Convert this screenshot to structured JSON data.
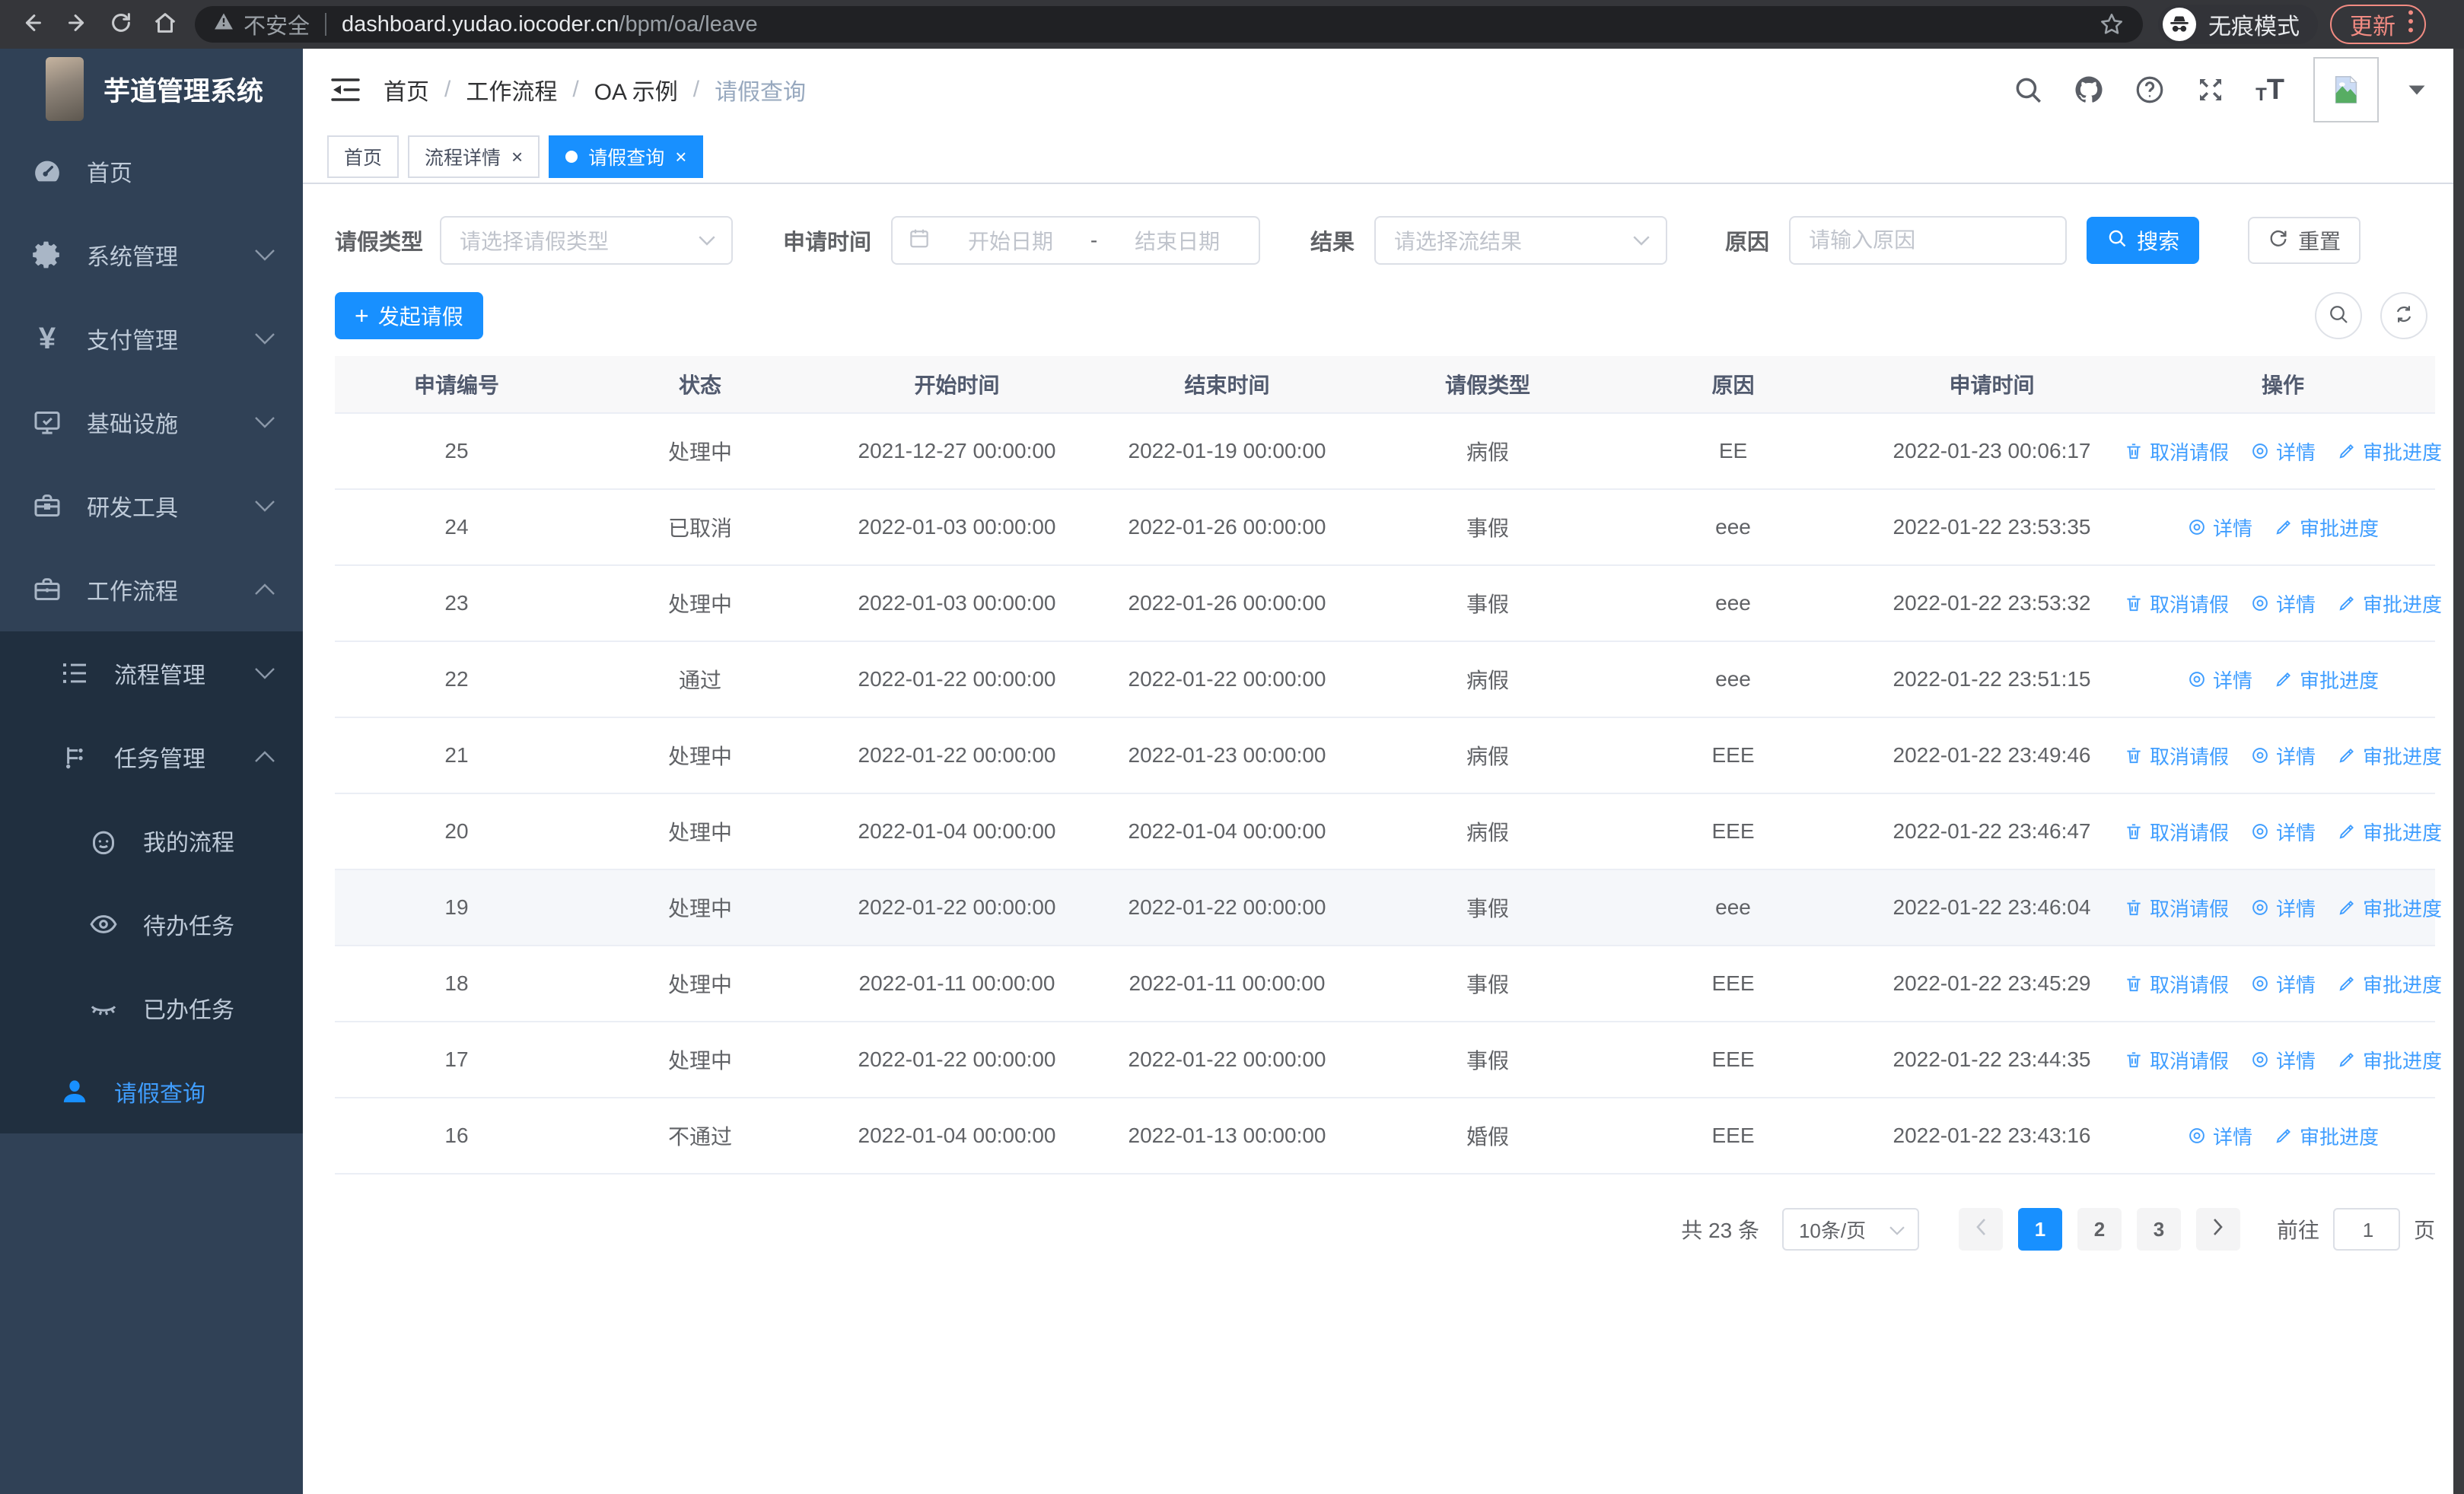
{
  "browser": {
    "security_label": "不安全",
    "url_host": "dashboard.yudao.iocoder.cn",
    "url_path": "/bpm/oa/leave",
    "incognito_label": "无痕模式",
    "update_label": "更新"
  },
  "sidebar": {
    "app_title": "芋道管理系统",
    "items": [
      {
        "label": "首页"
      },
      {
        "label": "系统管理"
      },
      {
        "label": "支付管理"
      },
      {
        "label": "基础设施"
      },
      {
        "label": "研发工具"
      },
      {
        "label": "工作流程"
      }
    ],
    "sub_items": [
      {
        "label": "流程管理"
      },
      {
        "label": "任务管理"
      },
      {
        "label": "我的流程"
      },
      {
        "label": "待办任务"
      },
      {
        "label": "已办任务"
      },
      {
        "label": "请假查询"
      }
    ]
  },
  "header": {
    "breadcrumb": [
      "首页",
      "工作流程",
      "OA 示例",
      "请假查询"
    ]
  },
  "tabs": [
    {
      "label": "首页"
    },
    {
      "label": "流程详情"
    },
    {
      "label": "请假查询"
    }
  ],
  "filters": {
    "leave_type_label": "请假类型",
    "leave_type_placeholder": "请选择请假类型",
    "apply_time_label": "申请时间",
    "start_date_placeholder": "开始日期",
    "range_separator": "-",
    "end_date_placeholder": "结束日期",
    "result_label": "结果",
    "result_placeholder": "请选择流结果",
    "reason_label": "原因",
    "reason_placeholder": "请输入原因",
    "search_label": "搜索",
    "reset_label": "重置"
  },
  "toolbar": {
    "create_label": "发起请假"
  },
  "table": {
    "columns": [
      "申请编号",
      "状态",
      "开始时间",
      "结束时间",
      "请假类型",
      "原因",
      "申请时间",
      "操作"
    ],
    "action_labels": {
      "cancel": "取消请假",
      "detail": "详情",
      "progress": "审批进度"
    },
    "rows": [
      {
        "id": "25",
        "status": "处理中",
        "start": "2021-12-27 00:00:00",
        "end": "2022-01-19 00:00:00",
        "type": "病假",
        "reason": "EE",
        "apply_time": "2022-01-23 00:06:17",
        "actions": [
          "cancel",
          "detail",
          "progress"
        ],
        "highlighted": false
      },
      {
        "id": "24",
        "status": "已取消",
        "start": "2022-01-03 00:00:00",
        "end": "2022-01-26 00:00:00",
        "type": "事假",
        "reason": "eee",
        "apply_time": "2022-01-22 23:53:35",
        "actions": [
          "detail",
          "progress"
        ],
        "highlighted": false
      },
      {
        "id": "23",
        "status": "处理中",
        "start": "2022-01-03 00:00:00",
        "end": "2022-01-26 00:00:00",
        "type": "事假",
        "reason": "eee",
        "apply_time": "2022-01-22 23:53:32",
        "actions": [
          "cancel",
          "detail",
          "progress"
        ],
        "highlighted": false
      },
      {
        "id": "22",
        "status": "通过",
        "start": "2022-01-22 00:00:00",
        "end": "2022-01-22 00:00:00",
        "type": "病假",
        "reason": "eee",
        "apply_time": "2022-01-22 23:51:15",
        "actions": [
          "detail",
          "progress"
        ],
        "highlighted": false
      },
      {
        "id": "21",
        "status": "处理中",
        "start": "2022-01-22 00:00:00",
        "end": "2022-01-23 00:00:00",
        "type": "病假",
        "reason": "EEE",
        "apply_time": "2022-01-22 23:49:46",
        "actions": [
          "cancel",
          "detail",
          "progress"
        ],
        "highlighted": false
      },
      {
        "id": "20",
        "status": "处理中",
        "start": "2022-01-04 00:00:00",
        "end": "2022-01-04 00:00:00",
        "type": "病假",
        "reason": "EEE",
        "apply_time": "2022-01-22 23:46:47",
        "actions": [
          "cancel",
          "detail",
          "progress"
        ],
        "highlighted": false
      },
      {
        "id": "19",
        "status": "处理中",
        "start": "2022-01-22 00:00:00",
        "end": "2022-01-22 00:00:00",
        "type": "事假",
        "reason": "eee",
        "apply_time": "2022-01-22 23:46:04",
        "actions": [
          "cancel",
          "detail",
          "progress"
        ],
        "highlighted": true
      },
      {
        "id": "18",
        "status": "处理中",
        "start": "2022-01-11 00:00:00",
        "end": "2022-01-11 00:00:00",
        "type": "事假",
        "reason": "EEE",
        "apply_time": "2022-01-22 23:45:29",
        "actions": [
          "cancel",
          "detail",
          "progress"
        ],
        "highlighted": false
      },
      {
        "id": "17",
        "status": "处理中",
        "start": "2022-01-22 00:00:00",
        "end": "2022-01-22 00:00:00",
        "type": "事假",
        "reason": "EEE",
        "apply_time": "2022-01-22 23:44:35",
        "actions": [
          "cancel",
          "detail",
          "progress"
        ],
        "highlighted": false
      },
      {
        "id": "16",
        "status": "不通过",
        "start": "2022-01-04 00:00:00",
        "end": "2022-01-13 00:00:00",
        "type": "婚假",
        "reason": "EEE",
        "apply_time": "2022-01-22 23:43:16",
        "actions": [
          "detail",
          "progress"
        ],
        "highlighted": false
      }
    ]
  },
  "pagination": {
    "total_text": "共 23 条",
    "page_size": "10条/页",
    "pages": [
      "1",
      "2",
      "3"
    ],
    "active_page": "1",
    "goto_label": "前往",
    "goto_value": "1",
    "page_suffix": "页"
  },
  "colors": {
    "primary": "#1890ff",
    "link": "#409eff",
    "sidebar_bg": "#304156",
    "sidebar_submenu_bg": "#202f3f",
    "update_accent": "#f28b82"
  }
}
